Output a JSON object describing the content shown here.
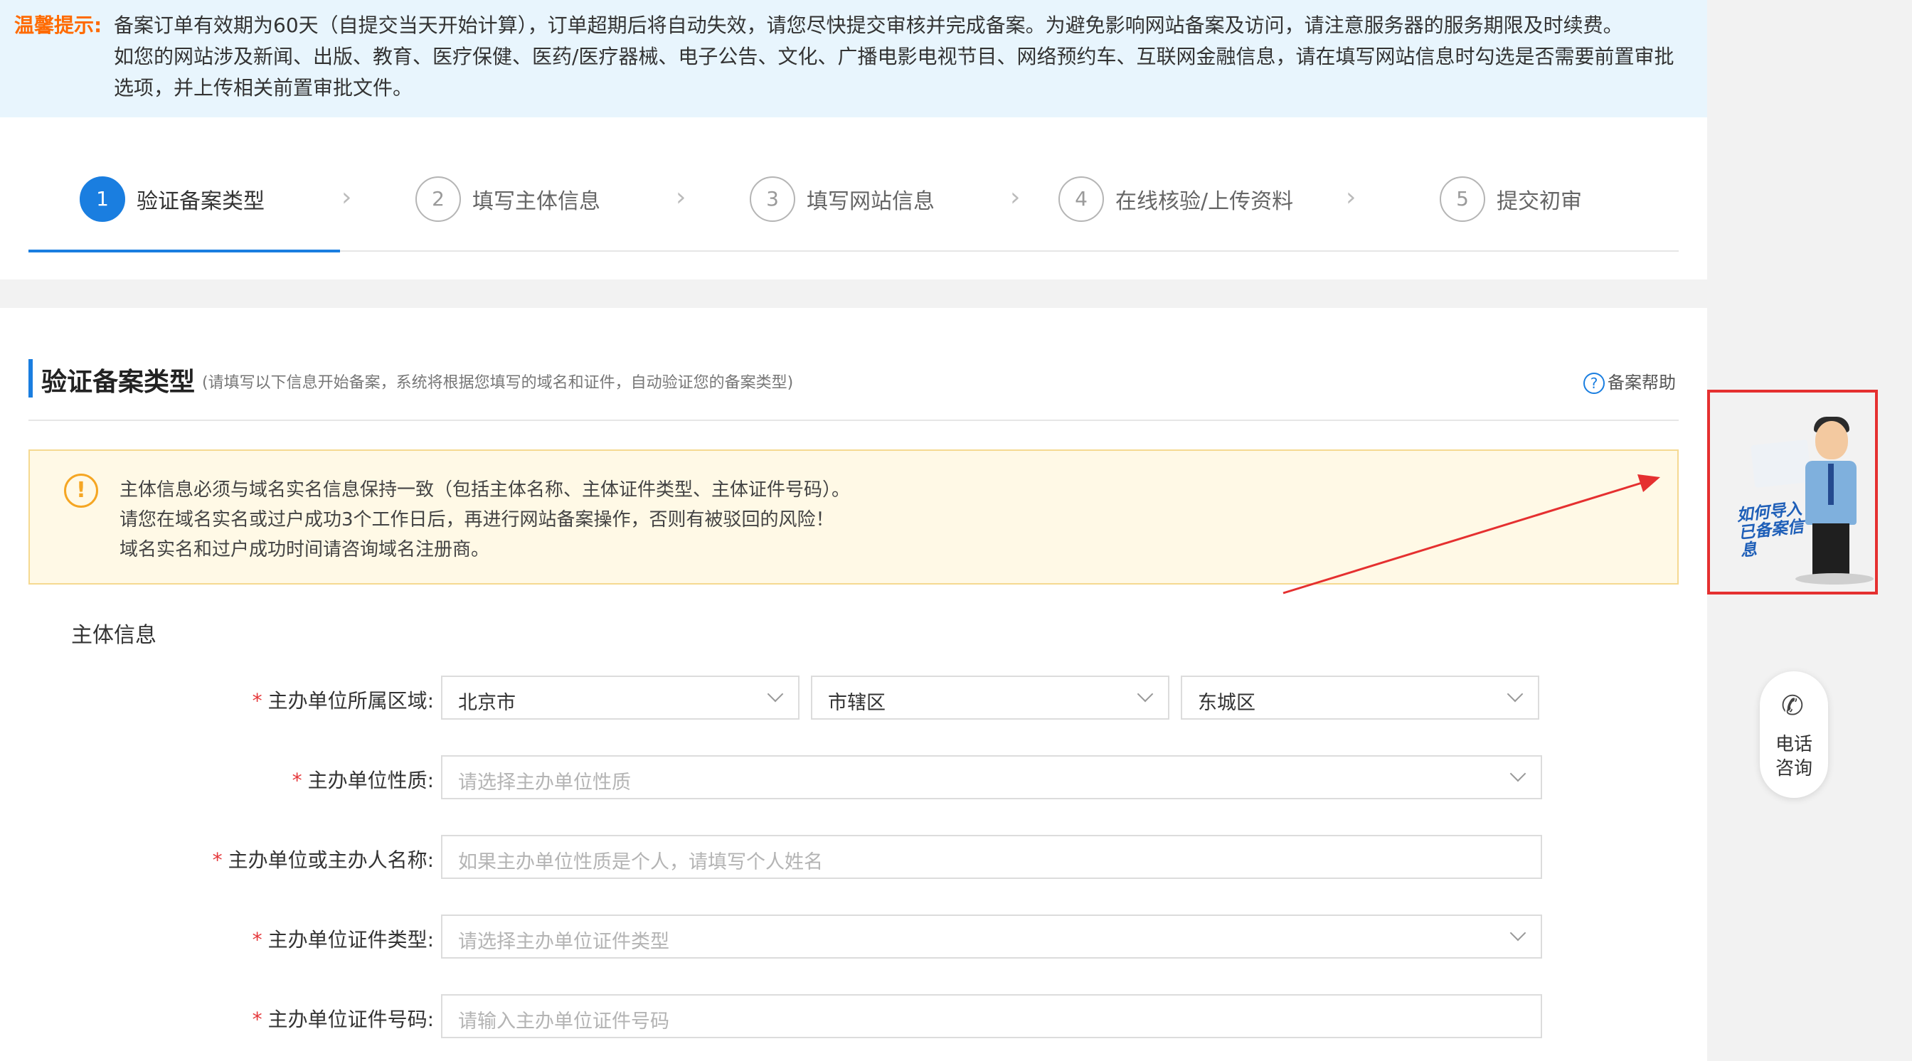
{
  "notice": {
    "tag": "温馨提示:",
    "line1": "备案订单有效期为60天（自提交当天开始计算），订单超期后将自动失效，请您尽快提交审核并完成备案。为避免影响网站备案及访问，请注意服务器的服务期限及时续费。",
    "line2": "如您的网站涉及新闻、出版、教育、医疗保健、医药/医疗器械、电子公告、文化、广播电影电视节目、网络预约车、互联网金融信息，请在填写网站信息时勾选是否需要前置审批",
    "line3": "选项，并上传相关前置审批文件。"
  },
  "steps": [
    {
      "num": "1",
      "label": "验证备案类型"
    },
    {
      "num": "2",
      "label": "填写主体信息"
    },
    {
      "num": "3",
      "label": "填写网站信息"
    },
    {
      "num": "4",
      "label": "在线核验/上传资料"
    },
    {
      "num": "5",
      "label": "提交初审"
    }
  ],
  "section": {
    "title": "验证备案类型",
    "subtitle": "(请填写以下信息开始备案，系统将根据您填写的域名和证件，自动验证您的备案类型)",
    "help": "备案帮助"
  },
  "warning": {
    "line1": "主体信息必须与域名实名信息保持一致（包括主体名称、主体证件类型、主体证件号码）。",
    "line2": "请您在域名实名或过户成功3个工作日后，再进行网站备案操作，否则有被驳回的风险！",
    "line3": "域名实名和过户成功时间请咨询域名注册商。"
  },
  "form": {
    "group_title": "主体信息",
    "required_mark": "*",
    "region": {
      "label": "主办单位所属区域:",
      "province": "北京市",
      "city": "市辖区",
      "district": "东城区"
    },
    "nature": {
      "label": "主办单位性质:",
      "placeholder": "请选择主办单位性质"
    },
    "name": {
      "label": "主办单位或主办人名称:",
      "placeholder": "如果主办单位性质是个人，请填写个人姓名"
    },
    "cert_type": {
      "label": "主办单位证件类型:",
      "placeholder": "请选择主办单位证件类型"
    },
    "cert_no": {
      "label": "主办单位证件号码:",
      "placeholder": "请输入主办单位证件号码"
    }
  },
  "side": {
    "promo_text": "如何导入已备案信息",
    "phone_line1": "电话",
    "phone_line2": "咨询"
  }
}
